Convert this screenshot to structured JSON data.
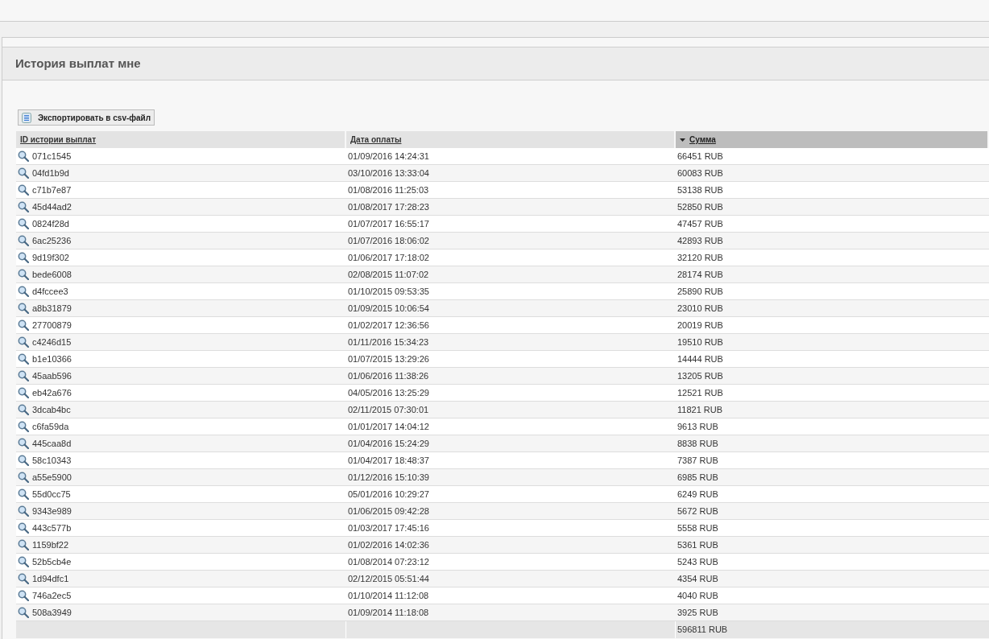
{
  "panel": {
    "title": "История выплат мне"
  },
  "export_button": {
    "label": "Экспортировать в csv-файл"
  },
  "table": {
    "columns": [
      {
        "label": "ID истории выплат",
        "sorted": false
      },
      {
        "label": "Дата оплаты",
        "sorted": false
      },
      {
        "label": "Сумма",
        "sorted": true
      }
    ],
    "rows": [
      [
        "071c1545",
        "01/09/2016 14:24:31",
        "66451 RUB"
      ],
      [
        "04fd1b9d",
        "03/10/2016 13:33:04",
        "60083 RUB"
      ],
      [
        "c71b7e87",
        "01/08/2016 11:25:03",
        "53138 RUB"
      ],
      [
        "45d44ad2",
        "01/08/2017 17:28:23",
        "52850 RUB"
      ],
      [
        "0824f28d",
        "01/07/2017 16:55:17",
        "47457 RUB"
      ],
      [
        "6ac25236",
        "01/07/2016 18:06:02",
        "42893 RUB"
      ],
      [
        "9d19f302",
        "01/06/2017 17:18:02",
        "32120 RUB"
      ],
      [
        "bede6008",
        "02/08/2015 11:07:02",
        "28174 RUB"
      ],
      [
        "d4fccee3",
        "01/10/2015 09:53:35",
        "25890 RUB"
      ],
      [
        "a8b31879",
        "01/09/2015 10:06:54",
        "23010 RUB"
      ],
      [
        "27700879",
        "01/02/2017 12:36:56",
        "20019 RUB"
      ],
      [
        "c4246d15",
        "01/11/2016 15:34:23",
        "19510 RUB"
      ],
      [
        "b1e10366",
        "01/07/2015 13:29:26",
        "14444 RUB"
      ],
      [
        "45aab596",
        "01/06/2016 11:38:26",
        "13205 RUB"
      ],
      [
        "eb42a676",
        "04/05/2016 13:25:29",
        "12521 RUB"
      ],
      [
        "3dcab4bc",
        "02/11/2015 07:30:01",
        "11821 RUB"
      ],
      [
        "c6fa59da",
        "01/01/2017 14:04:12",
        "9613 RUB"
      ],
      [
        "445caa8d",
        "01/04/2016 15:24:29",
        "8838 RUB"
      ],
      [
        "58c10343",
        "01/04/2017 18:48:37",
        "7387 RUB"
      ],
      [
        "a55e5900",
        "01/12/2016 15:10:39",
        "6985 RUB"
      ],
      [
        "55d0cc75",
        "05/01/2016 10:29:27",
        "6249 RUB"
      ],
      [
        "9343e989",
        "01/06/2015 09:42:28",
        "5672 RUB"
      ],
      [
        "443c577b",
        "01/03/2017 17:45:16",
        "5558 RUB"
      ],
      [
        "1159bf22",
        "01/02/2016 14:02:36",
        "5361 RUB"
      ],
      [
        "52b5cb4e",
        "01/08/2014 07:23:12",
        "5243 RUB"
      ],
      [
        "1d94dfc1",
        "02/12/2015 05:51:44",
        "4354 RUB"
      ],
      [
        "746a2ec5",
        "01/10/2014 11:12:08",
        "4040 RUB"
      ],
      [
        "508a3949",
        "01/09/2014 11:18:08",
        "3925 RUB"
      ]
    ],
    "total": "596811 RUB"
  }
}
